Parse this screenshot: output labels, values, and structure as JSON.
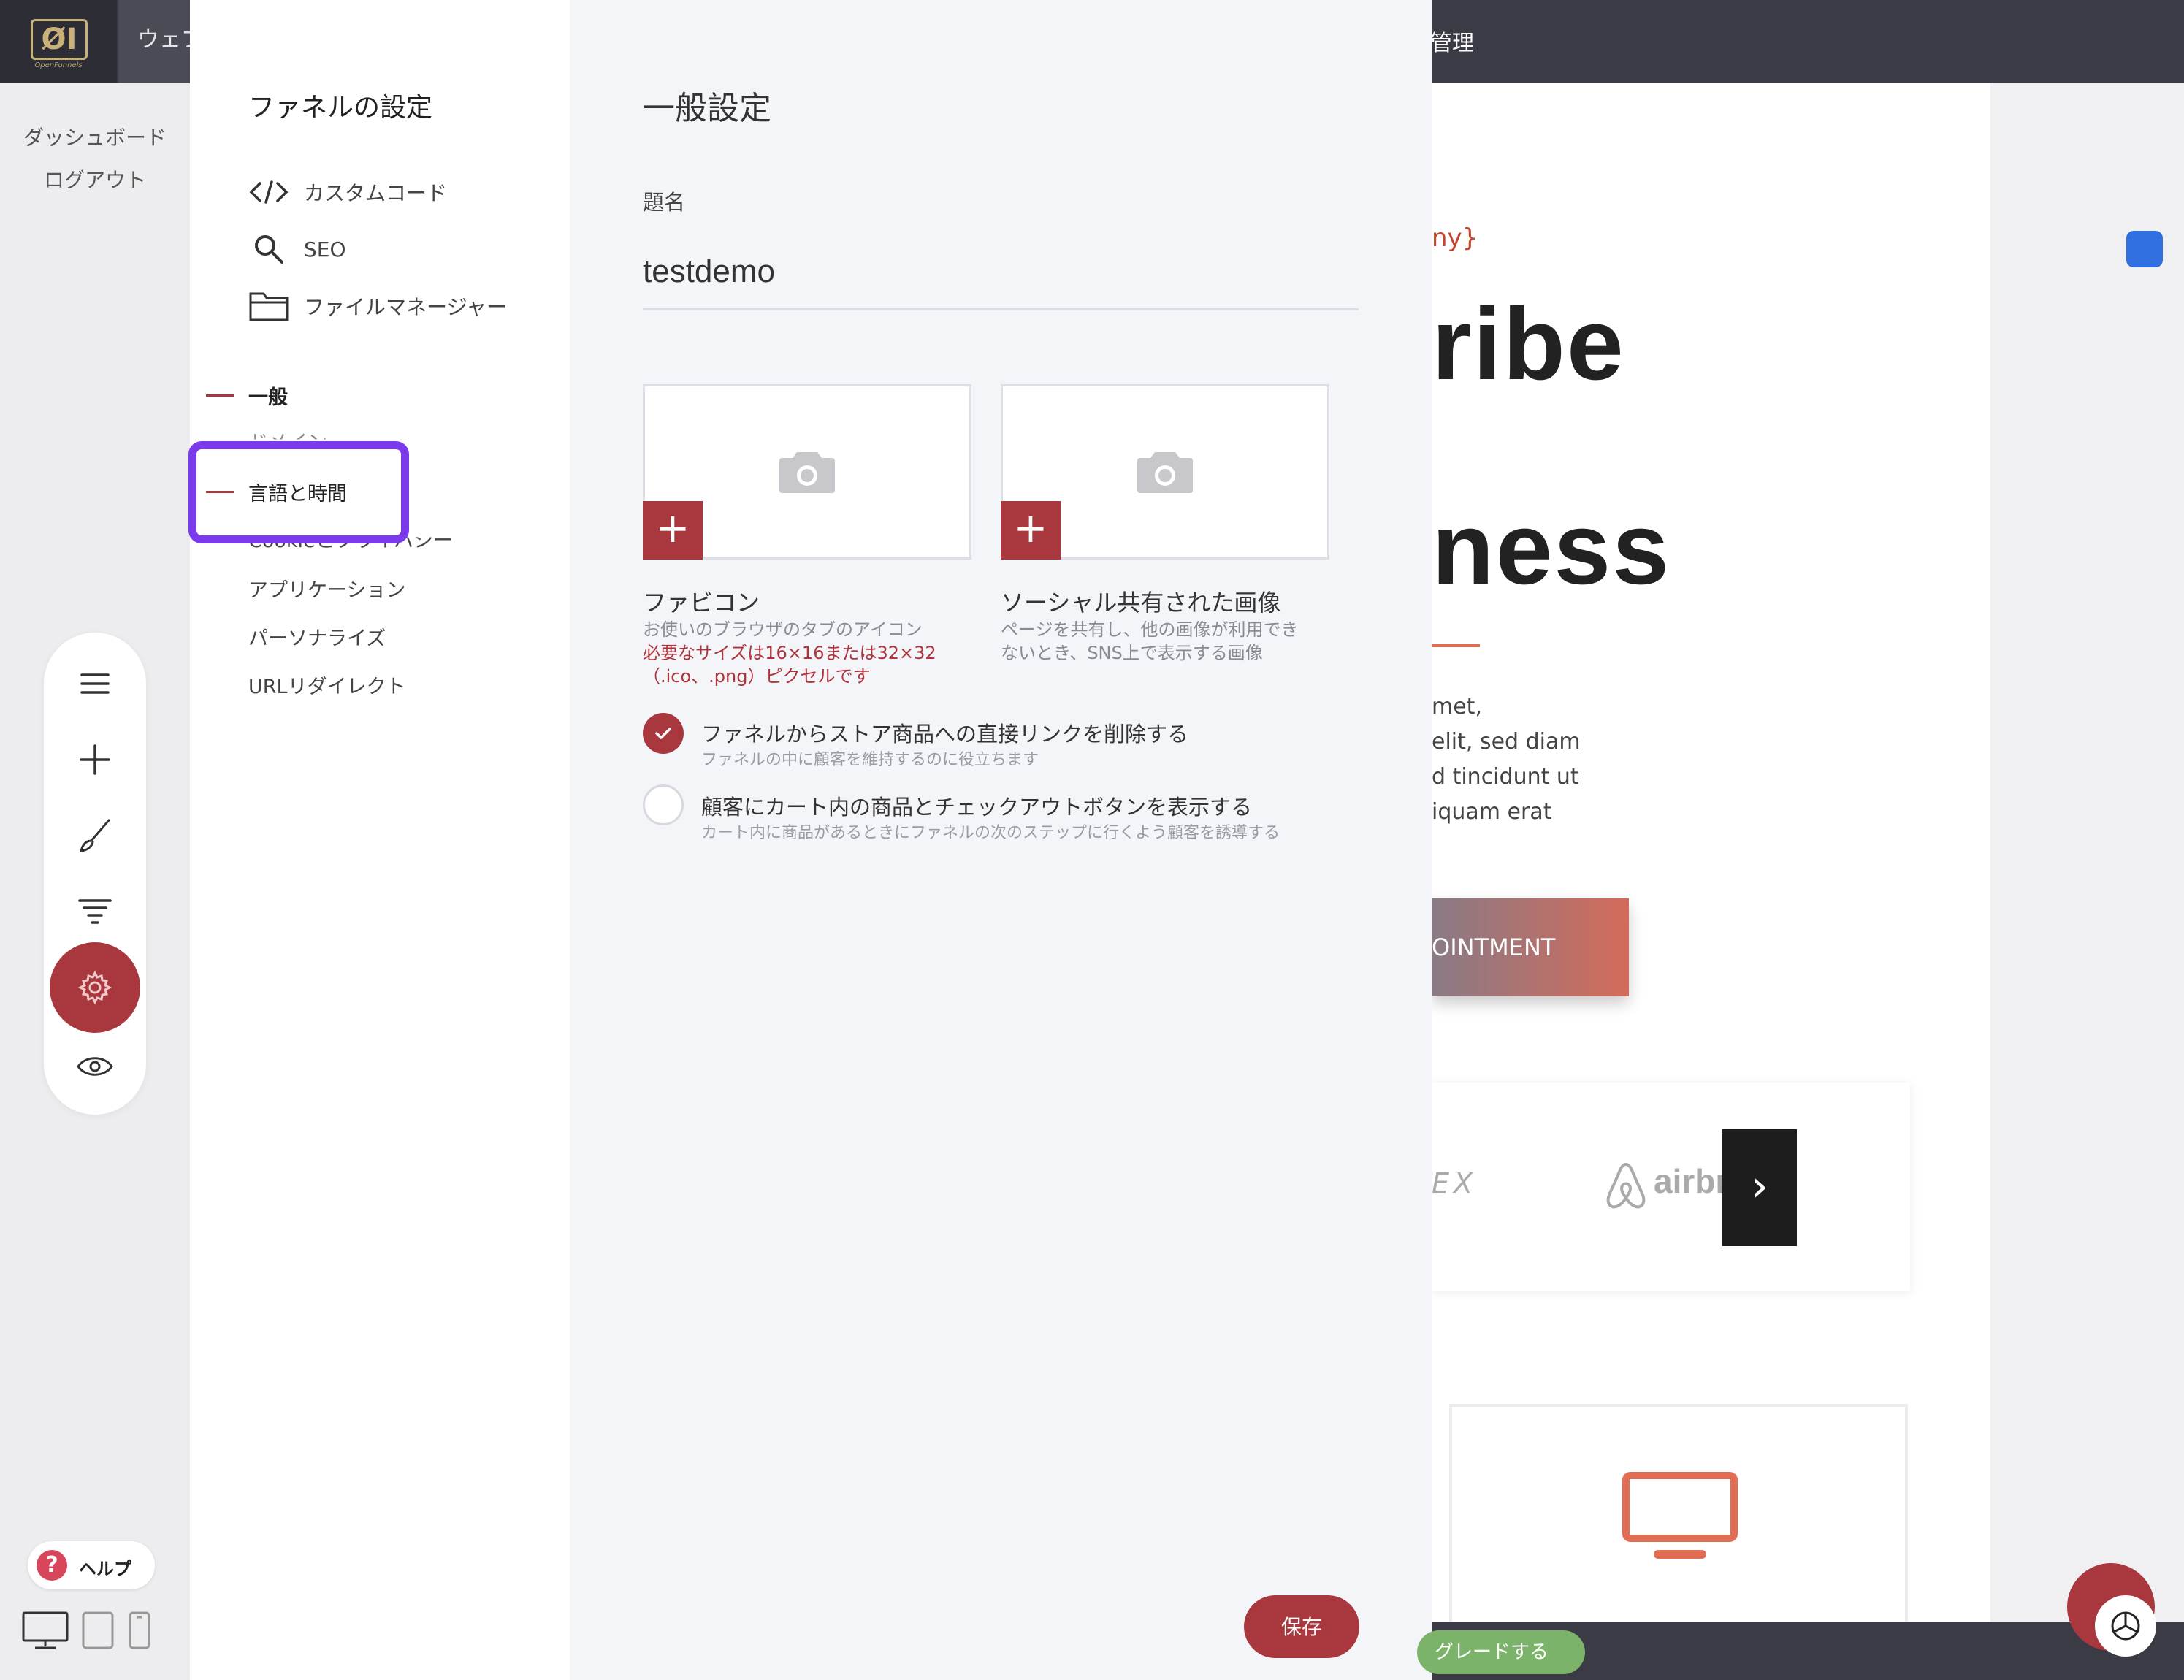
{
  "topbar": {
    "logo_text": "ØI",
    "logo_sub": "OpenFunnels",
    "title": "ウェブ",
    "manage": "管理"
  },
  "sidebar": {
    "dashboard": "ダッシュボード",
    "logout": "ログアウト",
    "help": "ヘルプ",
    "tools": [
      "menu-icon",
      "plus-icon",
      "brush-icon",
      "filter-icon",
      "gear-icon",
      "eye-icon"
    ],
    "devices": [
      "desktop-icon",
      "tablet-icon",
      "mobile-icon"
    ]
  },
  "settings_nav": {
    "title": "ファネルの設定",
    "tools": [
      {
        "label": "カスタムコード",
        "icon": "code-icon"
      },
      {
        "label": "SEO",
        "icon": "search-icon"
      },
      {
        "label": "ファイルマネージャー",
        "icon": "folder-icon"
      }
    ],
    "sections": [
      {
        "label": "一般",
        "active": true
      },
      {
        "label": "ドメイン",
        "active": false
      },
      {
        "label": "言語と時間",
        "active": true
      },
      {
        "label": "Cookieとプライバシー",
        "active": false
      },
      {
        "label": "アプリケーション",
        "active": false
      },
      {
        "label": "パーソナライズ",
        "active": false
      },
      {
        "label": "URLリダイレクト",
        "active": false
      }
    ]
  },
  "general": {
    "heading": "一般設定",
    "name_label": "題名",
    "name_value": "testdemo",
    "favicon": {
      "title": "ファビコン",
      "desc": "お使いのブラウザのタブのアイコン",
      "req1": "必要なサイズは16×16または32×32",
      "req2": "（.ico、.png）ピクセルです",
      "plus": "+"
    },
    "social": {
      "title": "ソーシャル共有された画像",
      "desc1": "ページを共有し、他の画像が利用でき",
      "desc2": "ないとき、SNS上で表示する画像",
      "plus": "+"
    },
    "checks": [
      {
        "title": "ファネルからストア商品への直接リンクを削除する",
        "sub": "ファネルの中に顧客を維持するのに役立ちます",
        "checked": true
      },
      {
        "title": "顧客にカート内の商品とチェックアウトボタンを表示する",
        "sub": "カート内に商品があるときにファネルの次のステップに行くよう顧客を誘導する",
        "checked": false
      }
    ],
    "save": "保存"
  },
  "preview": {
    "company": "ny}",
    "big1": "ribe",
    "big2": "ness",
    "body": [
      "met,",
      "elit, sed diam",
      "d tincidunt ut",
      "iquam erat"
    ],
    "cta": "OINTMENT",
    "logo1": "EX",
    "logo2": "airbn",
    "next": "›"
  },
  "bottom": {
    "upgrade": "グレードする"
  },
  "colors": {
    "accent": "#a8383d",
    "highlight": "#7c3aed",
    "topbar": "#3a3b45",
    "preview_accent": "#e06d54"
  }
}
